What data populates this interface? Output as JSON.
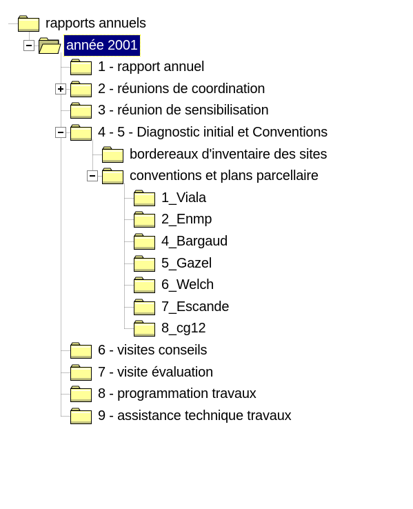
{
  "colors": {
    "selection_bg": "#000080",
    "selection_fg": "#ffffff",
    "folder_fill": "#ffff99",
    "folder_shade": "#c0c080"
  },
  "tree": {
    "nodes": [
      {
        "label": "rapports annuels",
        "depth": 0,
        "expander": "none",
        "icon": "folder-closed-icon",
        "selected": false
      },
      {
        "label": "année 2001",
        "depth": 1,
        "expander": "minus",
        "icon": "folder-open-icon",
        "selected": true
      },
      {
        "label": "1 - rapport annuel",
        "depth": 2,
        "expander": "none",
        "icon": "folder-closed-icon",
        "selected": false
      },
      {
        "label": "2 - réunions de coordination",
        "depth": 2,
        "expander": "plus",
        "icon": "folder-closed-icon",
        "selected": false
      },
      {
        "label": "3 - réunion de sensibilisation",
        "depth": 2,
        "expander": "none",
        "icon": "folder-closed-icon",
        "selected": false
      },
      {
        "label": "4 - 5 - Diagnostic initial et Conventions",
        "depth": 2,
        "expander": "minus",
        "icon": "folder-closed-icon",
        "selected": false
      },
      {
        "label": "bordereaux d'inventaire des sites",
        "depth": 3,
        "expander": "none",
        "icon": "folder-closed-icon",
        "selected": false
      },
      {
        "label": "conventions et plans parcellaire",
        "depth": 3,
        "expander": "minus",
        "icon": "folder-closed-icon",
        "selected": false
      },
      {
        "label": "1_Viala",
        "depth": 4,
        "expander": "none",
        "icon": "folder-closed-icon",
        "selected": false
      },
      {
        "label": "2_Enmp",
        "depth": 4,
        "expander": "none",
        "icon": "folder-closed-icon",
        "selected": false
      },
      {
        "label": "4_Bargaud",
        "depth": 4,
        "expander": "none",
        "icon": "folder-closed-icon",
        "selected": false
      },
      {
        "label": "5_Gazel",
        "depth": 4,
        "expander": "none",
        "icon": "folder-closed-icon",
        "selected": false
      },
      {
        "label": "6_Welch",
        "depth": 4,
        "expander": "none",
        "icon": "folder-closed-icon",
        "selected": false
      },
      {
        "label": "7_Escande",
        "depth": 4,
        "expander": "none",
        "icon": "folder-closed-icon",
        "selected": false
      },
      {
        "label": "8_cg12",
        "depth": 4,
        "expander": "none",
        "icon": "folder-closed-icon",
        "selected": false
      },
      {
        "label": "6 - visites conseils",
        "depth": 2,
        "expander": "none",
        "icon": "folder-closed-icon",
        "selected": false
      },
      {
        "label": "7 - visite évaluation",
        "depth": 2,
        "expander": "none",
        "icon": "folder-closed-icon",
        "selected": false
      },
      {
        "label": "8 - programmation travaux",
        "depth": 2,
        "expander": "none",
        "icon": "folder-closed-icon",
        "selected": false
      },
      {
        "label": "9 - assistance technique travaux",
        "depth": 2,
        "expander": "none",
        "icon": "folder-closed-icon",
        "selected": false
      }
    ]
  }
}
